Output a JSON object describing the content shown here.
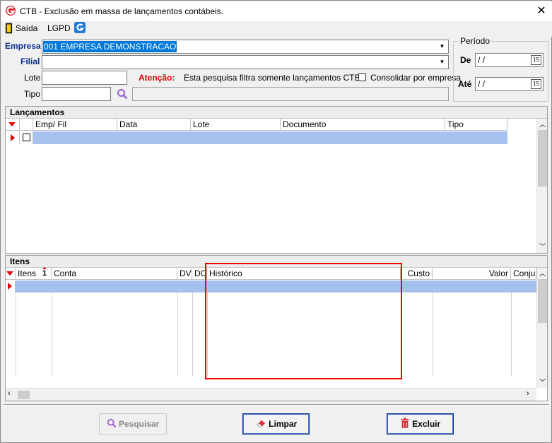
{
  "window": {
    "title": "CTB - Exclusão em massa de lançamentos contábeis.",
    "close": "✕"
  },
  "toolbar": {
    "saida": "Saída",
    "lgpd": "LGPD"
  },
  "form": {
    "empresa_label": "Empresa",
    "empresa_value": "001 EMPRESA DEMONSTRACAO",
    "filial_label": "Filial",
    "filial_value": "",
    "lote_label": "Lote",
    "lote_value": "",
    "tipo_label": "Tipo",
    "tipo_value": "",
    "atencao_label": "Atenção:",
    "atencao_text": "Esta pesquisa filtra somente lançamentos CTB.",
    "consolidar_label": "Consolidar por empresa"
  },
  "periodo": {
    "title": "Período",
    "de_label": "De",
    "de_value": " / /",
    "ate_label": "Até",
    "ate_value": " / /",
    "cal_icon": "15"
  },
  "lancamentos": {
    "title": "Lançamentos",
    "columns": [
      "Emp/ Fil",
      "Data",
      "Lote",
      "Documento",
      "Tipo"
    ]
  },
  "itens": {
    "title": "Itens",
    "columns": [
      "Itens",
      "Conta",
      "DV",
      "DC",
      "Histórico",
      "Custo",
      "Valor",
      "Conjur"
    ],
    "sort_indicator": "1"
  },
  "buttons": {
    "pesquisar": "Pesquisar",
    "limpar": "Limpar",
    "excluir": "Excluir"
  },
  "colors": {
    "selection": "#0078d7",
    "row_highlight": "#a7c1ef",
    "accent_red": "#e00000",
    "label_blue": "#0b2f8a"
  }
}
